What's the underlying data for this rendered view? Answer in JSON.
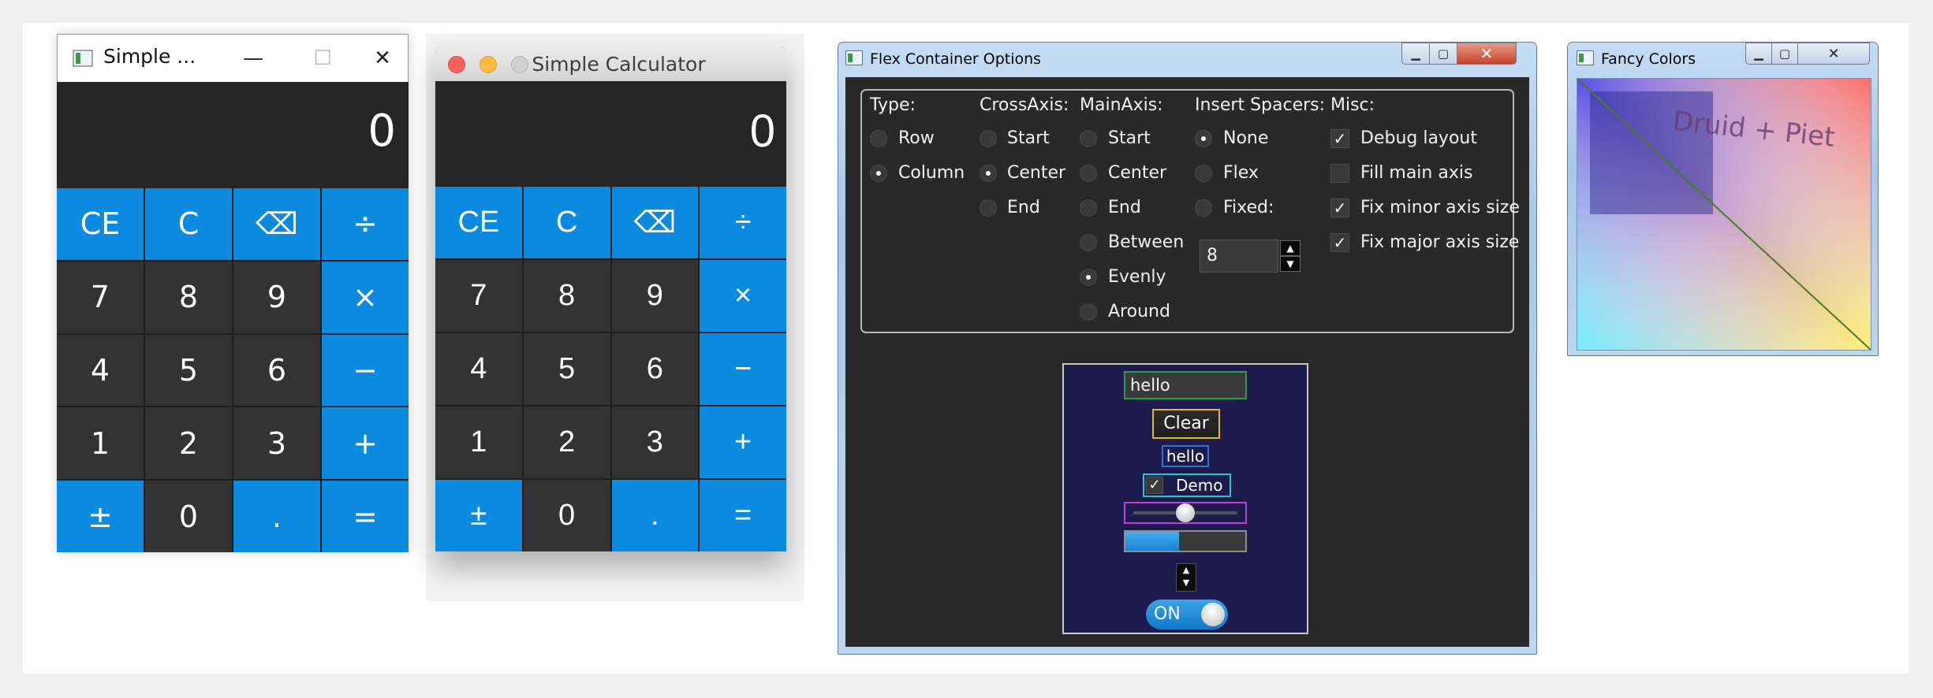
{
  "calc_windows": {
    "title_short": "Simple ...",
    "controls": {
      "minimize": "—",
      "maximize": "☐",
      "close": "✕"
    },
    "display": "0"
  },
  "calc_mac": {
    "title": "Simple Calculator",
    "display": "0"
  },
  "calc_keys": [
    {
      "label": "CE",
      "name": "ce-button",
      "style": "blue"
    },
    {
      "label": "C",
      "name": "clear-button",
      "style": "blue"
    },
    {
      "label": "⌫",
      "name": "backspace-button",
      "style": "blue"
    },
    {
      "label": "÷",
      "name": "divide-button",
      "style": "blue"
    },
    {
      "label": "7",
      "name": "digit-7-button",
      "style": "dark"
    },
    {
      "label": "8",
      "name": "digit-8-button",
      "style": "dark"
    },
    {
      "label": "9",
      "name": "digit-9-button",
      "style": "dark"
    },
    {
      "label": "×",
      "name": "multiply-button",
      "style": "blue"
    },
    {
      "label": "4",
      "name": "digit-4-button",
      "style": "dark"
    },
    {
      "label": "5",
      "name": "digit-5-button",
      "style": "dark"
    },
    {
      "label": "6",
      "name": "digit-6-button",
      "style": "dark"
    },
    {
      "label": "−",
      "name": "subtract-button",
      "style": "blue"
    },
    {
      "label": "1",
      "name": "digit-1-button",
      "style": "dark"
    },
    {
      "label": "2",
      "name": "digit-2-button",
      "style": "dark"
    },
    {
      "label": "3",
      "name": "digit-3-button",
      "style": "dark"
    },
    {
      "label": "+",
      "name": "add-button",
      "style": "blue"
    },
    {
      "label": "±",
      "name": "negate-button",
      "style": "blue"
    },
    {
      "label": "0",
      "name": "digit-0-button",
      "style": "dark"
    },
    {
      "label": ".",
      "name": "decimal-button",
      "style": "blue"
    },
    {
      "label": "=",
      "name": "equals-button",
      "style": "blue"
    }
  ],
  "flex": {
    "title": "Flex Container Options",
    "type": {
      "label": "Type:",
      "options": [
        "Row",
        "Column"
      ],
      "selected": "Column"
    },
    "cross_axis": {
      "label": "CrossAxis:",
      "options": [
        "Start",
        "Center",
        "End"
      ],
      "selected": "Center"
    },
    "main_axis": {
      "label": "MainAxis:",
      "options": [
        "Start",
        "Center",
        "End",
        "Between",
        "Evenly",
        "Around"
      ],
      "selected": "Evenly"
    },
    "spacers": {
      "label": "Insert Spacers:",
      "options": [
        "None",
        "Flex",
        "Fixed:"
      ],
      "selected": "None",
      "fixed_value": "8"
    },
    "misc": {
      "label": "Misc:",
      "options": [
        {
          "label": "Debug layout",
          "checked": true
        },
        {
          "label": "Fill main axis",
          "checked": false
        },
        {
          "label": "Fix minor axis size",
          "checked": true
        },
        {
          "label": "Fix major axis size",
          "checked": true
        }
      ]
    },
    "demo": {
      "textbox_value": "hello",
      "clear_label": "Clear",
      "label_text": "hello",
      "checkbox_label": "Demo",
      "checkbox_checked": true,
      "slider_value": 0.5,
      "progress_value": 0.45,
      "switch_label": "ON",
      "switch_on": true
    }
  },
  "fancy": {
    "title": "Fancy Colors",
    "canvas_text": "Druid + Piet"
  },
  "colors": {
    "calc_blue": "#0b8ae0",
    "calc_dark": "#333333",
    "flex_bg": "#292929",
    "demo_bg": "#1d1b4d"
  }
}
